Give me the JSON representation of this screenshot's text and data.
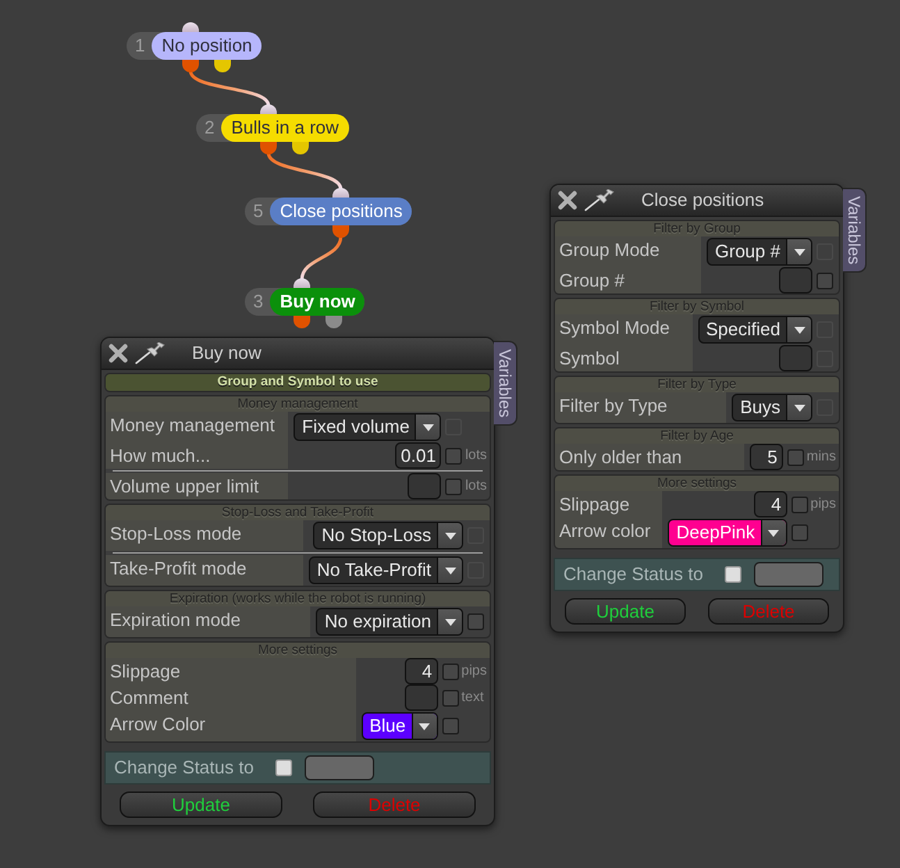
{
  "graph": {
    "nodes": [
      {
        "number": "1",
        "label": "No position",
        "color": "#b6b6fb",
        "selected": false,
        "outputs": [
          {
            "color": "#e05200",
            "connected": true
          },
          {
            "color": "#e4c600",
            "connected": false
          }
        ]
      },
      {
        "number": "2",
        "label": "Bulls in a row",
        "color": "#f5dc00",
        "selected": false,
        "outputs": [
          {
            "color": "#e05200",
            "connected": true
          },
          {
            "color": "#e4c600",
            "connected": false
          }
        ]
      },
      {
        "number": "5",
        "label": "Close positions",
        "color": "#5a7ec6",
        "selected": false,
        "outputs": [
          {
            "color": "#e05200",
            "connected": true
          }
        ]
      },
      {
        "number": "3",
        "label": "Buy now",
        "color": "#0b900b",
        "selected": true,
        "outputs": [
          {
            "color": "#e05200"
          },
          {
            "color": "#8b8b8b"
          }
        ]
      }
    ]
  },
  "panels": [
    {
      "title": "Buy now",
      "side_tab": "Variables",
      "sections": [
        {
          "title": "Group and Symbol to use",
          "highlighted": true
        },
        {
          "title": "Money management",
          "highlighted": false,
          "rows": [
            {
              "kind": "dropdown",
              "label": "Money management",
              "value": "Fixed volume",
              "checkbox": {
                "checked": false,
                "disabled": true
              }
            },
            {
              "kind": "input",
              "label": "How much...",
              "value": "0.01",
              "unit": "lots",
              "checkbox": {
                "checked": false,
                "disabled": false
              }
            },
            {
              "kind": "input",
              "label": "Volume upper limit",
              "divider_before": true,
              "unit": "lots",
              "checkbox": {
                "checked": false,
                "disabled": false
              }
            }
          ]
        },
        {
          "title": "Stop-Loss and Take-Profit",
          "highlighted": false,
          "rows": [
            {
              "kind": "dropdown",
              "label": "Stop-Loss mode",
              "value": "No Stop-Loss",
              "checkbox": {
                "checked": false,
                "disabled": true
              }
            },
            {
              "kind": "dropdown",
              "label": "Take-Profit mode",
              "value": "No Take-Profit",
              "divider_before": true,
              "checkbox": {
                "checked": false,
                "disabled": true
              }
            }
          ]
        },
        {
          "title": "Expiration (works while the robot is running)",
          "highlighted": false,
          "rows": [
            {
              "kind": "dropdown",
              "label": "Expiration mode",
              "value": "No expiration",
              "checkbox": {
                "checked": false,
                "disabled": false
              }
            }
          ]
        },
        {
          "title": "More settings",
          "highlighted": false,
          "rows": [
            {
              "kind": "input",
              "label": "Slippage",
              "value": "4",
              "unit": "pips",
              "checkbox": {
                "checked": false,
                "disabled": false
              }
            },
            {
              "kind": "input",
              "label": "Comment",
              "unit": "text",
              "checkbox": {
                "checked": false,
                "disabled": false
              }
            },
            {
              "kind": "color",
              "label": "Arrow Color",
              "value": "Blue",
              "color": "#5c00ff",
              "checkbox": {
                "checked": false,
                "disabled": false
              }
            }
          ]
        }
      ],
      "change_status": {
        "label": "Change Status to",
        "checked": false
      },
      "buttons": [
        {
          "label": "Update",
          "kind": "update"
        },
        {
          "label": "Delete",
          "kind": "delete"
        }
      ]
    },
    {
      "title": "Close positions",
      "side_tab": "Variables",
      "sections": [
        {
          "title": "Filter by Group",
          "highlighted": false,
          "rows": [
            {
              "kind": "dropdown",
              "label": "Group Mode",
              "value": "Group #",
              "checkbox": {
                "checked": false,
                "disabled": true
              }
            },
            {
              "kind": "input",
              "label": "Group #",
              "checkbox": {
                "checked": false,
                "disabled": false
              }
            }
          ]
        },
        {
          "title": "Filter by Symbol",
          "highlighted": false,
          "rows": [
            {
              "kind": "dropdown",
              "label": "Symbol Mode",
              "value": "Specified",
              "checkbox": {
                "checked": false,
                "disabled": true
              }
            },
            {
              "kind": "input",
              "label": "Symbol",
              "checkbox": {
                "checked": false,
                "disabled": true
              }
            }
          ]
        },
        {
          "title": "Filter by Type",
          "highlighted": false,
          "rows": [
            {
              "kind": "dropdown",
              "label": "Filter by Type",
              "value": "Buys",
              "checkbox": {
                "checked": false,
                "disabled": true
              }
            }
          ]
        },
        {
          "title": "Filter by Age",
          "highlighted": false,
          "rows": [
            {
              "kind": "input",
              "label": "Only older than",
              "value": "5",
              "unit": "mins",
              "checkbox": {
                "checked": false,
                "disabled": false
              }
            }
          ]
        },
        {
          "title": "More settings",
          "highlighted": false,
          "rows": [
            {
              "kind": "input",
              "label": "Slippage",
              "value": "4",
              "unit": "pips",
              "checkbox": {
                "checked": false,
                "disabled": false
              }
            },
            {
              "kind": "color",
              "label": "Arrow color",
              "value": "DeepPink",
              "color": "#ff0090",
              "checkbox": {
                "checked": false,
                "disabled": false
              }
            }
          ]
        }
      ],
      "change_status": {
        "label": "Change Status to",
        "checked": false
      },
      "buttons": [
        {
          "label": "Update",
          "kind": "update"
        },
        {
          "label": "Delete",
          "kind": "delete"
        }
      ]
    }
  ]
}
